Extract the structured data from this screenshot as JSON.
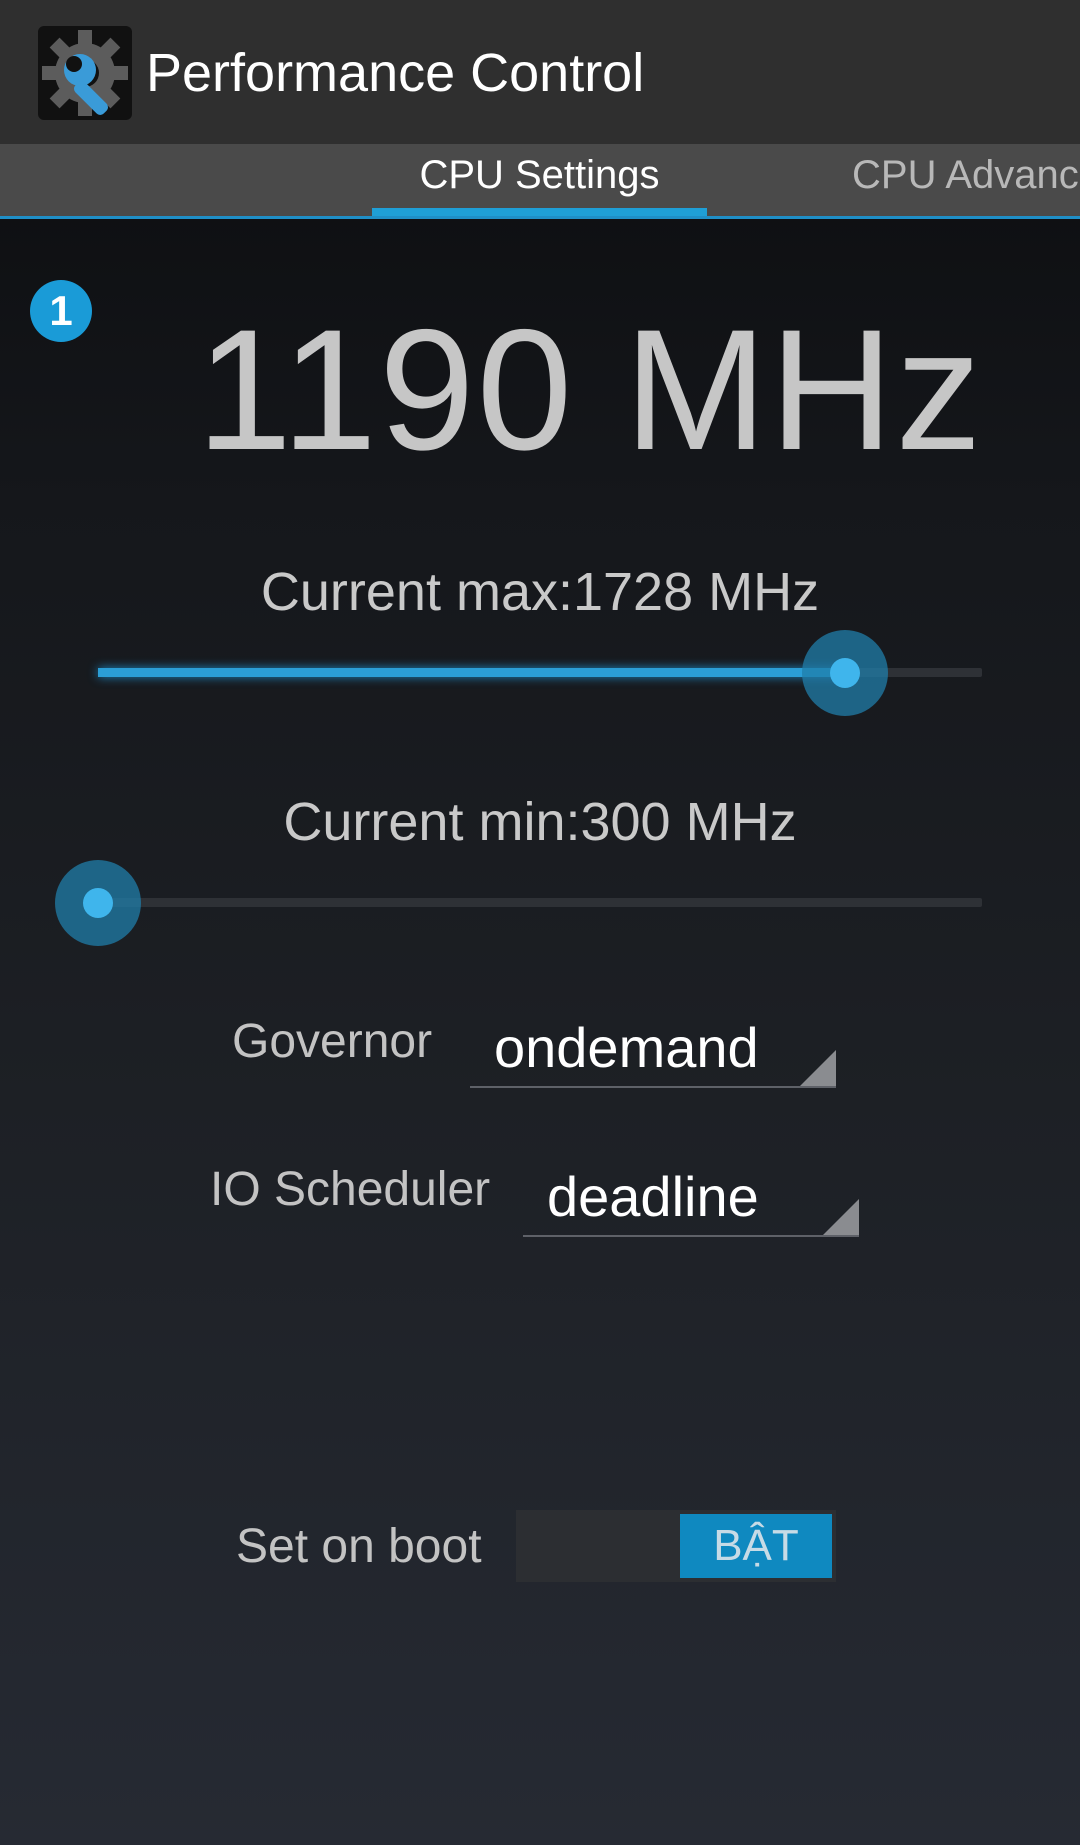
{
  "app": {
    "title": "Performance Control",
    "icon": "gear-wrench-icon"
  },
  "tabs": [
    {
      "label": "CPU Settings",
      "active": true
    },
    {
      "label": "CPU Advanc",
      "active": false
    }
  ],
  "badge": "1",
  "current_frequency": "1190 MHz",
  "max_slider": {
    "label": "Current max:1728 MHz",
    "fraction": 0.845
  },
  "min_slider": {
    "label": "Current min:300 MHz",
    "fraction": 0.0
  },
  "governor": {
    "label": "Governor",
    "value": "ondemand"
  },
  "io_scheduler": {
    "label": "IO Scheduler",
    "value": "deadline"
  },
  "set_on_boot": {
    "label": "Set on boot",
    "state_text": "BẬT",
    "on": true
  },
  "colors": {
    "accent": "#1f9fd6",
    "action_bar": "#2f2f2f",
    "tab_strip": "#4a4a4a"
  }
}
